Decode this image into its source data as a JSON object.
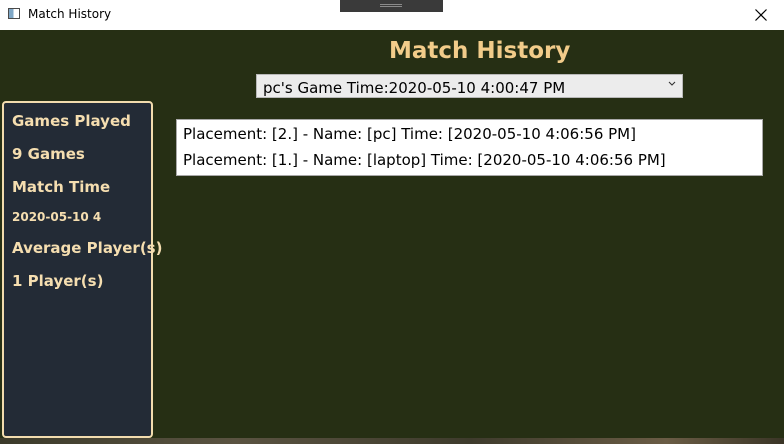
{
  "window": {
    "title": "Match History",
    "close_glyph": "close-icon"
  },
  "header": {
    "title": "Match History"
  },
  "game_select": {
    "selected": "pc's Game Time:2020-05-10 4:00:47 PM"
  },
  "stats": {
    "games_played_label": "Games Played",
    "games_played_value": "9 Games",
    "match_time_label": "Match Time",
    "match_time_value": "2020-05-10 4",
    "average_players_label": "Average Player(s)",
    "average_players_value": "1 Player(s)"
  },
  "results": [
    {
      "text": "Placement: [2.] - Name: [pc] Time: [2020-05-10 4:06:56 PM]"
    },
    {
      "text": "Placement: [1.] - Name: [laptop] Time: [2020-05-10 4:06:56 PM]"
    }
  ],
  "colors": {
    "background": "#262f14",
    "accent_text": "#f2cc8a",
    "panel_bg": "#232b36",
    "panel_border": "#f2dcae"
  }
}
